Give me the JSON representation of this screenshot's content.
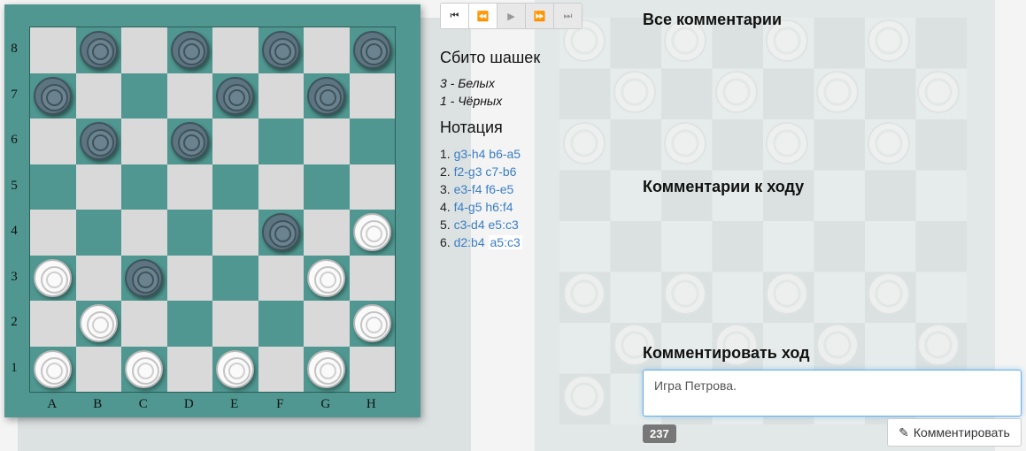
{
  "board": {
    "ranks": [
      "8",
      "7",
      "6",
      "5",
      "4",
      "3",
      "2",
      "1"
    ],
    "files": [
      "A",
      "B",
      "C",
      "D",
      "E",
      "F",
      "G",
      "H"
    ],
    "pieces": [
      {
        "square": "b8",
        "color": "black"
      },
      {
        "square": "d8",
        "color": "black"
      },
      {
        "square": "f8",
        "color": "black"
      },
      {
        "square": "h8",
        "color": "black"
      },
      {
        "square": "a7",
        "color": "black"
      },
      {
        "square": "e7",
        "color": "black"
      },
      {
        "square": "g7",
        "color": "black"
      },
      {
        "square": "b6",
        "color": "black"
      },
      {
        "square": "d6",
        "color": "black"
      },
      {
        "square": "f4",
        "color": "black"
      },
      {
        "square": "h4",
        "color": "white"
      },
      {
        "square": "a3",
        "color": "white"
      },
      {
        "square": "c3",
        "color": "black"
      },
      {
        "square": "g3",
        "color": "white"
      },
      {
        "square": "b2",
        "color": "white"
      },
      {
        "square": "h2",
        "color": "white"
      },
      {
        "square": "a1",
        "color": "white"
      },
      {
        "square": "c1",
        "color": "white"
      },
      {
        "square": "e1",
        "color": "white"
      },
      {
        "square": "g1",
        "color": "white"
      }
    ]
  },
  "controls": [
    {
      "name": "first-move-button",
      "icon": "⏮",
      "disabled": false
    },
    {
      "name": "prev-move-button",
      "icon": "⏪",
      "disabled": false
    },
    {
      "name": "play-button",
      "icon": "▶",
      "disabled": true
    },
    {
      "name": "next-move-button",
      "icon": "⏩",
      "disabled": true
    },
    {
      "name": "last-move-button",
      "icon": "⏭",
      "disabled": true
    }
  ],
  "captured": {
    "title": "Сбито шашек",
    "white": "3 - Белых",
    "black": "1 - Чёрных"
  },
  "notation": {
    "title": "Нотация",
    "moves": [
      {
        "num": "1.",
        "white": "g3-h4",
        "black": "b6-a5"
      },
      {
        "num": "2.",
        "white": "f2-g3",
        "black": "c7-b6"
      },
      {
        "num": "3.",
        "white": "e3-f4",
        "black": "f6-e5"
      },
      {
        "num": "4.",
        "white": "f4-g5",
        "black": "h6:f4"
      },
      {
        "num": "5.",
        "white": "c3-d4",
        "black": "e5:c3"
      },
      {
        "num": "6.",
        "white": "d2:b4",
        "black": "a5:c3"
      }
    ]
  },
  "comments": {
    "all_title": "Все комментарии",
    "move_title": "Комментарии к ходу",
    "comment_title": "Комментировать ход",
    "input_value": "Игра Петрова.",
    "char_count": "237",
    "submit_label": "Комментировать"
  },
  "colors": {
    "board_dark": "#4f9790",
    "board_light": "#d9d9d9",
    "link": "#3a7ec4",
    "focus": "#66afe9"
  }
}
